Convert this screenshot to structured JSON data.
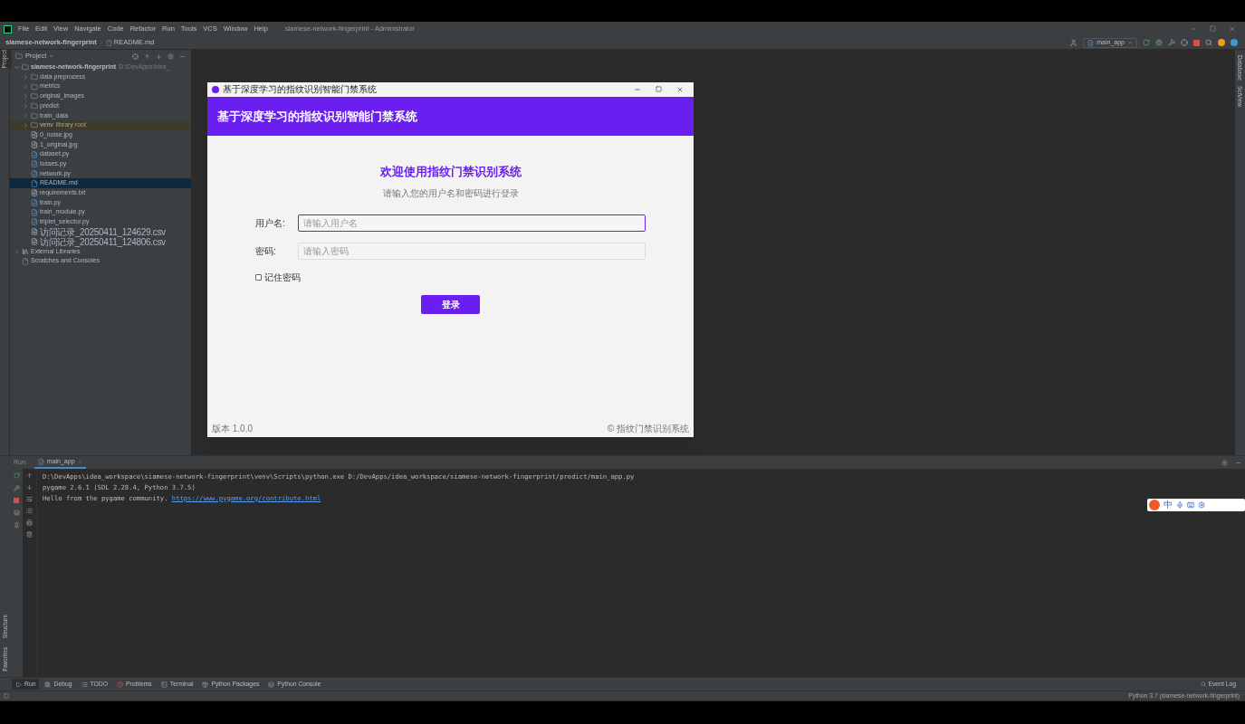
{
  "ide": {
    "menu": [
      "File",
      "Edit",
      "View",
      "Navigate",
      "Code",
      "Refactor",
      "Run",
      "Tools",
      "VCS",
      "Window",
      "Help"
    ],
    "window_title": "siamese-network-fingerprint - Administrator",
    "breadcrumbs": [
      "siamese-network-fingerprint",
      "README.md"
    ],
    "run_config": "main_app",
    "left_strip": [
      "Project"
    ],
    "left_strip_bottom": [
      "Structure",
      "Favorites"
    ],
    "right_strip": [
      "Database",
      "SciView"
    ],
    "project_panel": {
      "title": "Project",
      "tree": [
        {
          "label": "siamese-network-fingerprint",
          "note": "D:\\DevApps\\idea_",
          "kind": "folder",
          "expanded": true,
          "selected": false,
          "children": [
            {
              "label": "data preprocess",
              "kind": "folder",
              "expanded": false,
              "selected": false
            },
            {
              "label": "metrics",
              "kind": "folder",
              "expanded": false,
              "selected": false
            },
            {
              "label": "original_images",
              "kind": "folder",
              "expanded": false,
              "selected": false
            },
            {
              "label": "predict",
              "kind": "folder",
              "expanded": false,
              "selected": false
            },
            {
              "label": "train_data",
              "kind": "folder",
              "expanded": false,
              "selected": false
            },
            {
              "label": "venv",
              "tag": "library root",
              "kind": "folder",
              "expanded": false,
              "selected": false
            },
            {
              "label": "0_noise.jpg",
              "kind": "image",
              "selected": false
            },
            {
              "label": "1_original.jpg",
              "kind": "image",
              "selected": false
            },
            {
              "label": "dataset.py",
              "kind": "python",
              "selected": false
            },
            {
              "label": "losses.py",
              "kind": "python",
              "selected": false
            },
            {
              "label": "network.py",
              "kind": "python",
              "selected": false
            },
            {
              "label": "README.md",
              "kind": "markdown",
              "selected": true
            },
            {
              "label": "requirements.txt",
              "kind": "text",
              "selected": false
            },
            {
              "label": "train.py",
              "kind": "python",
              "selected": false
            },
            {
              "label": "train_module.py",
              "kind": "python",
              "selected": false
            },
            {
              "label": "triplet_selector.py",
              "kind": "python",
              "selected": false
            },
            {
              "label": "访问记录_20250411_124629.csv",
              "kind": "csv",
              "selected": false
            },
            {
              "label": "访问记录_20250411_124806.csv",
              "kind": "csv",
              "selected": false
            }
          ]
        },
        {
          "label": "External Libraries",
          "kind": "libraries",
          "expanded": false,
          "selected": false
        },
        {
          "label": "Scratches and Consoles",
          "kind": "scratches",
          "selected": false
        }
      ]
    },
    "run_panel": {
      "label": "Run:",
      "tab": "main_app",
      "lines": [
        {
          "text": "D:\\DevApps\\idea_workspace\\siamese-network-fingerprint\\venv\\Scripts\\python.exe D:/DevApps/idea_workspace/siamese-network-fingerprint/predict/main_app.py"
        },
        {
          "text": "pygame 2.6.1 (SDL 2.28.4, Python 3.7.5)"
        },
        {
          "text": "Hello from the pygame community. ",
          "link": "https://www.pygame.org/contribute.html"
        }
      ]
    },
    "tool_tabs": [
      {
        "label": "Run",
        "kind": "run",
        "selected": true
      },
      {
        "label": "Debug",
        "kind": "debug",
        "selected": false
      },
      {
        "label": "TODO",
        "kind": "todo",
        "selected": false
      },
      {
        "label": "Problems",
        "kind": "problems",
        "selected": false
      },
      {
        "label": "Terminal",
        "kind": "terminal",
        "selected": false
      },
      {
        "label": "Python Packages",
        "kind": "packages",
        "selected": false
      },
      {
        "label": "Python Console",
        "kind": "console",
        "selected": false
      }
    ],
    "event_log": "Event Log",
    "status": "Python 3.7 (siamese-network-fingerprint)"
  },
  "ime": {
    "label": "中"
  },
  "app_window": {
    "title": "基于深度学习的指纹识别智能门禁系统",
    "header": "基于深度学习的指纹识别智能门禁系统",
    "welcome": "欢迎使用指纹门禁识别系统",
    "subtitle": "请输入您的用户名和密码进行登录",
    "fields": [
      {
        "label": "用户名:",
        "placeholder": "请输入用户名",
        "focused": true
      },
      {
        "label": "密码:",
        "placeholder": "请输入密码",
        "focused": false
      }
    ],
    "remember": {
      "label": "记住密码",
      "checked": false
    },
    "login_button": "登录",
    "version": "版本 1.0.0",
    "copyright": "© 指纹门禁识别系统"
  }
}
